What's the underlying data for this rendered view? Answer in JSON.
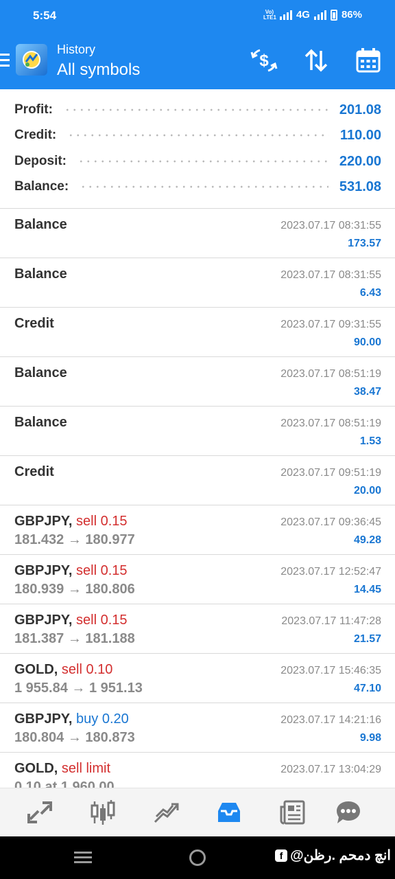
{
  "status_bar": {
    "time": "5:54",
    "network": "4G",
    "volte": "Vo) LTE1",
    "battery": "86%"
  },
  "app_bar": {
    "title": "History",
    "subtitle": "All symbols",
    "icons": [
      "menu-icon",
      "metatrader-logo",
      "dollar-swap-icon",
      "sort-icon",
      "calendar-icon"
    ]
  },
  "summary": [
    {
      "label": "Profit:",
      "value": "201.08"
    },
    {
      "label": "Credit:",
      "value": "110.00"
    },
    {
      "label": "Deposit:",
      "value": "220.00"
    },
    {
      "label": "Balance:",
      "value": "531.08"
    }
  ],
  "deals": [
    {
      "type": "op",
      "name": "Balance",
      "date": "2023.07.17 08:31:55",
      "amount": "173.57"
    },
    {
      "type": "op",
      "name": "Balance",
      "date": "2023.07.17 08:31:55",
      "amount": "6.43"
    },
    {
      "type": "op",
      "name": "Credit",
      "date": "2023.07.17 09:31:55",
      "amount": "90.00"
    },
    {
      "type": "op",
      "name": "Balance",
      "date": "2023.07.17 08:51:19",
      "amount": "38.47"
    },
    {
      "type": "op",
      "name": "Balance",
      "date": "2023.07.17 08:51:19",
      "amount": "1.53"
    },
    {
      "type": "op",
      "name": "Credit",
      "date": "2023.07.17 09:51:19",
      "amount": "20.00"
    },
    {
      "type": "trade",
      "symbol": "GBPJPY,",
      "action": "sell 0.15",
      "side": "sell",
      "prices": "181.432 → 180.977",
      "date": "2023.07.17 09:36:45",
      "amount": "49.28"
    },
    {
      "type": "trade",
      "symbol": "GBPJPY,",
      "action": "sell 0.15",
      "side": "sell",
      "prices": "180.939 → 180.806",
      "date": "2023.07.17 12:52:47",
      "amount": "14.45"
    },
    {
      "type": "trade",
      "symbol": "GBPJPY,",
      "action": "sell 0.15",
      "side": "sell",
      "prices": "181.387 → 181.188",
      "date": "2023.07.17 11:47:28",
      "amount": "21.57"
    },
    {
      "type": "trade",
      "symbol": "GOLD,",
      "action": "sell 0.10",
      "side": "sell",
      "prices": "1 955.84 → 1 951.13",
      "date": "2023.07.17 15:46:35",
      "amount": "47.10"
    },
    {
      "type": "trade",
      "symbol": "GBPJPY,",
      "action": "buy 0.20",
      "side": "buy",
      "prices": "180.804 → 180.873",
      "date": "2023.07.17 14:21:16",
      "amount": "9.98"
    },
    {
      "type": "trade",
      "symbol": "GOLD,",
      "action": "sell limit",
      "side": "sell",
      "prices": "0.10 at 1 960.00",
      "date": "2023.07.17 13:04:29",
      "amount": ""
    }
  ],
  "bottom_nav": [
    "quotes-icon",
    "chart-icon",
    "trade-icon",
    "history-icon",
    "news-icon",
    "chat-icon"
  ],
  "active_tab": "history-icon",
  "watermark": "انچ دمحم .رظن@",
  "colors": {
    "accent": "#1e88f0",
    "profit_blue": "#1976d2",
    "sell_red": "#d32f2f"
  }
}
